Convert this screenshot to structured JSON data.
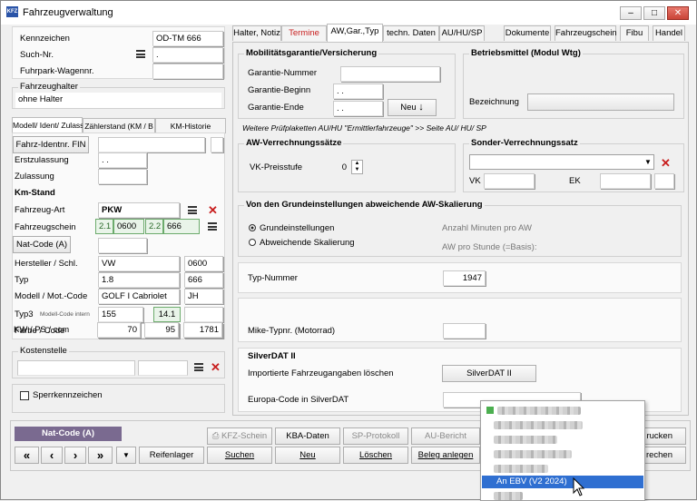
{
  "window": {
    "title": "Fahrzeugverwaltung",
    "icon_text": "KFZ"
  },
  "left": {
    "kennzeichen_label": "Kennzeichen",
    "kennzeichen_value": "OD-TM 666",
    "suchnr_label": "Such-Nr.",
    "suchnr_value": ".",
    "fuhrpark_label": "Fuhrpark-Wagennr.",
    "halter_group": "Fahrzeughalter",
    "halter_value": "ohne Halter",
    "tabs": [
      "Modell/ Ident/ Zulass",
      "Zählerstand (KM / B",
      "KM-Historie"
    ],
    "fin_button": "Fahrz-Identnr. FIN",
    "erstzulassung_label": "Erstzulassung",
    "erstzulassung_value": ". .",
    "zulassung_label": "Zulassung",
    "kmstand_label": "Km-Stand",
    "fahrzeugart_label": "Fahrzeug-Art",
    "fahrzeugart_value": "PKW",
    "fahrzeugschein_label": "Fahrzeugschein",
    "fs_a1": "2.1",
    "fs_a2": "0600",
    "fs_b1": "2.2",
    "fs_b2": "666",
    "natcode_button": "Nat-Code (A)",
    "hersteller_label": "Hersteller / Schl.",
    "hersteller_value": "VW",
    "hersteller_code": "0600",
    "typ_label": "Typ",
    "typ_value": "1.8",
    "typ_code": "666",
    "modell_label": "Modell / Mot.-Code",
    "modell_value": "GOLF I Cabriolet",
    "modell_code": "JH",
    "typ3_label": "Typ3",
    "typ3_hint": "Modell-Code intern",
    "typ3_value": "155",
    "typ3_code": "14.1",
    "farbe_label": "Farbe / Code",
    "kw_label": "KW / PS / ccm",
    "kw_value": "70",
    "ps_value": "95",
    "ccm_value": "1781",
    "kostenstelle_group": "Kostenstelle",
    "sperr_label": "Sperrkennzeichen"
  },
  "right": {
    "tabs": [
      "Halter, Notiz",
      "Termine",
      "AW,Gar.,Typ",
      "techn. Daten",
      "AU/HU/SP",
      "Dokumente",
      "Fahrzeugschein",
      "Fibu",
      "Handel"
    ],
    "mobil_group": "Mobilitätsgarantie/Versicherung",
    "garantie_nr": "Garantie-Nummer",
    "garantie_beginn": "Garantie-Beginn",
    "garantie_beginn_value": ". .",
    "garantie_ende": "Garantie-Ende",
    "garantie_ende_value": ". .",
    "neu_button": "Neu",
    "betrieb_group": "Betriebsmittel (Modul Wtg)",
    "bezeichnung": "Bezeichnung",
    "note": "Weitere Prüfplaketten AU/HU \"Ermittlerfahrzeuge\" >> Seite AU/ HU/ SP",
    "aw_group": "AW-Verrechnungssätze",
    "vk_preis": "VK-Preisstufe",
    "vk_preis_value": "0",
    "sonder_group": "Sonder-Verrechnungssatz",
    "vk": "VK",
    "ek": "EK",
    "skal_group": "Von den Grundeinstellungen abweichende AW-Skalierung",
    "radio1": "Grundeinstellungen",
    "radio2": "Abweichende Skalierung",
    "anzahl": "Anzahl Minuten pro AW",
    "aw_stunde": "AW pro Stunde (=Basis):",
    "typnr_label": "Typ-Nummer",
    "typnr_value": "1947",
    "mike_label": "Mike-Typnr. (Motorrad)",
    "silver_group": "SilverDAT II",
    "import_label": "Importierte Fahrzeugangaben löschen",
    "silver_button": "SilverDAT II",
    "europa_label": "Europa-Code in SilverDAT"
  },
  "bottom": {
    "natcode": "Nat-Code (A)",
    "kfz_schein": "KFZ-Schein",
    "kba": "KBA-Daten",
    "sp_protokoll": "SP-Protokoll",
    "au_bericht": "AU-Bericht",
    "reifenlager": "Reifenlager",
    "suchen": "Suchen",
    "neu": "Neu",
    "loeschen": "Löschen",
    "beleg": "Beleg anlegen",
    "drucken": "rucken",
    "rechen": "rechen"
  },
  "popup": {
    "selected": "An EBV (V2 2024)"
  }
}
